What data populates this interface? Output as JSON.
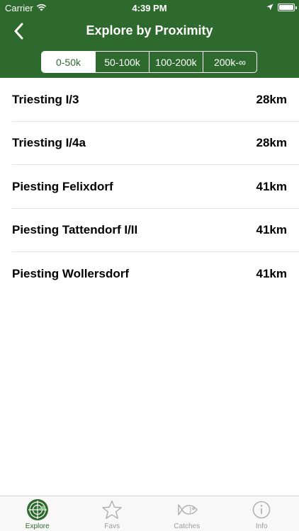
{
  "status_bar": {
    "carrier": "Carrier",
    "time": "4:39 PM"
  },
  "nav": {
    "title": "Explore by Proximity"
  },
  "segments": [
    {
      "label": "0-50k",
      "active": true
    },
    {
      "label": "50-100k",
      "active": false
    },
    {
      "label": "100-200k",
      "active": false
    },
    {
      "label": "200k-∞",
      "active": false
    }
  ],
  "list": [
    {
      "name": "Triesting I/3",
      "distance": "28km"
    },
    {
      "name": "Triesting I/4a",
      "distance": "28km"
    },
    {
      "name": "Piesting Felixdorf",
      "distance": "41km"
    },
    {
      "name": "Piesting Tattendorf I/II",
      "distance": "41km"
    },
    {
      "name": "Piesting Wollersdorf",
      "distance": "41km"
    }
  ],
  "tabs": [
    {
      "label": "Explore",
      "icon": "radar-icon",
      "active": true
    },
    {
      "label": "Favs",
      "icon": "star-icon",
      "active": false
    },
    {
      "label": "Catches",
      "icon": "fish-icon",
      "active": false
    },
    {
      "label": "Info",
      "icon": "info-icon",
      "active": false
    }
  ],
  "colors": {
    "brand_green": "#2e6a2d",
    "inactive_gray": "#9b9b9b"
  }
}
